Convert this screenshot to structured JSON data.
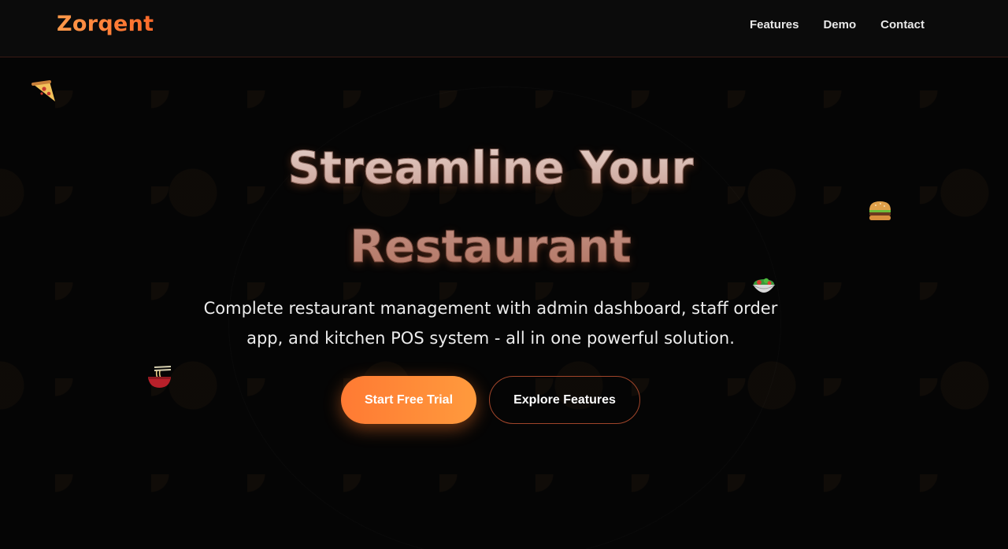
{
  "header": {
    "logo": "Zorqent",
    "nav": [
      {
        "label": "Features"
      },
      {
        "label": "Demo"
      },
      {
        "label": "Contact"
      }
    ]
  },
  "hero": {
    "title_line1": "Streamline Your",
    "title_line2": "Restaurant",
    "subtitle": "Complete restaurant management with admin dashboard, staff order app, and kitchen POS system - all in one powerful solution.",
    "primary_cta": "Start Free Trial",
    "secondary_cta": "Explore Features"
  },
  "decorations": {
    "icons": [
      "pizza-icon",
      "burger-icon",
      "salad-icon",
      "noodles-icon"
    ]
  },
  "colors": {
    "accent": "#ff8a3d",
    "background": "#050505",
    "nav_text": "#e8e8e8"
  }
}
